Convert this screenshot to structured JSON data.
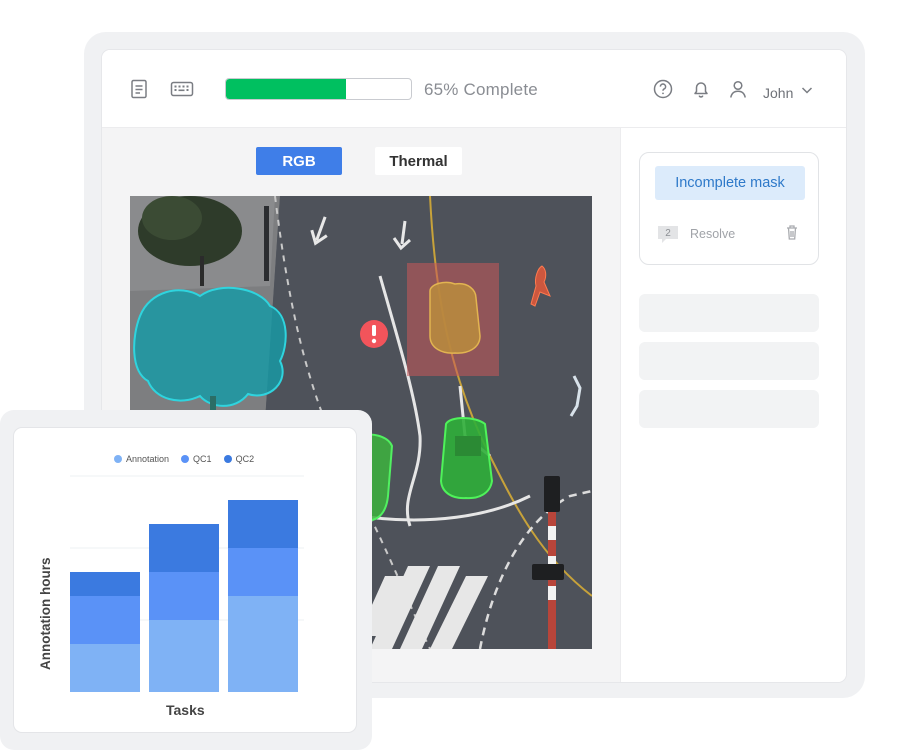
{
  "topbar": {
    "progress": {
      "percent": 65,
      "label": "65% Complete"
    },
    "user": {
      "name": "John"
    },
    "icons": [
      "document-icon",
      "keyboard-icon",
      "help-icon",
      "bell-icon",
      "user-icon",
      "chevron-down-icon"
    ]
  },
  "tabs": [
    {
      "label": "RGB",
      "active": true
    },
    {
      "label": "Thermal",
      "active": false
    }
  ],
  "comment": {
    "tag": "Incomplete mask",
    "reply_count": "2",
    "resolve_label": "Resolve"
  },
  "colors": {
    "accent": "#3f7ee8",
    "progress": "#00c060",
    "tree_mask": "#17a7b3",
    "car_brown_mask": "#c79a3a",
    "car_green_mask": "#38c43a",
    "pedestrian_mask": "#e45a3b",
    "issue_marker": "#f2545b",
    "annotation": "#7fb2f5",
    "qc1": "#5a92f7",
    "qc2": "#3b7ae0"
  },
  "chart_data": {
    "type": "bar",
    "stacked": true,
    "categories": [
      "",
      "",
      ""
    ],
    "series": [
      {
        "name": "Annotation",
        "values": [
          2,
          3,
          4
        ],
        "color": "#7fb2f5"
      },
      {
        "name": "QC1",
        "values": [
          2,
          2,
          2
        ],
        "color": "#5a92f7"
      },
      {
        "name": "QC2",
        "values": [
          1,
          2,
          2
        ],
        "color": "#3b7ae0"
      }
    ],
    "xlabel": "Tasks",
    "ylabel": "Annotation hours",
    "ylim": [
      0,
      9
    ],
    "grid": true,
    "legend_position": "top-center"
  }
}
